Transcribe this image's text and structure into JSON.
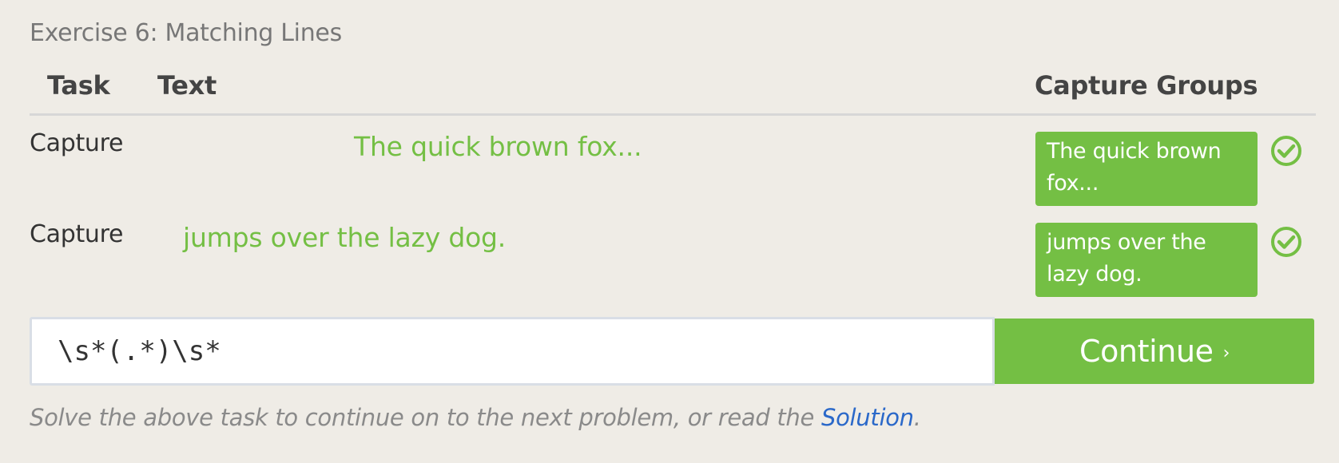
{
  "exercise": {
    "title": "Exercise 6: Matching Lines"
  },
  "table": {
    "headers": {
      "task": "Task",
      "text": "Text",
      "capture_groups": "Capture Groups"
    },
    "rows": [
      {
        "action": "Capture",
        "text": "The quick brown fox...",
        "capture_group": "The quick brown fox...",
        "status_icon": "check-circle-icon"
      },
      {
        "action": "Capture",
        "text": "jumps over the lazy dog.",
        "capture_group": "jumps over the lazy dog.",
        "status_icon": "check-circle-icon"
      }
    ]
  },
  "answer": {
    "value": "\\s*(.*)\\s*"
  },
  "continue_button": {
    "label": "Continue",
    "arrow": "›"
  },
  "footer": {
    "prefix": "Solve the above task to continue on to the next problem, or read the ",
    "link": "Solution",
    "suffix": "."
  },
  "colors": {
    "accent_green": "#74bf44",
    "background": "#efece6",
    "link_blue": "#2a68c9"
  }
}
